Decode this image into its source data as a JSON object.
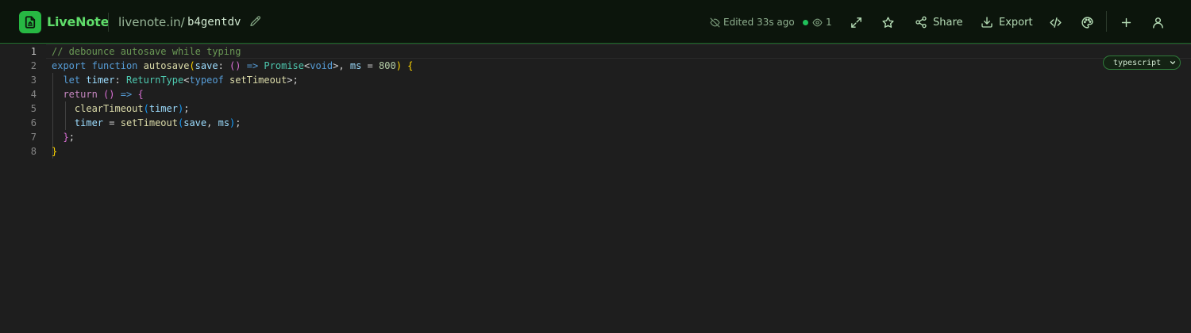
{
  "app": {
    "name": "LiveNote",
    "url_domain": "livenote.in/",
    "note_id": "b4gentdv"
  },
  "status": {
    "edited": "Edited 33s ago",
    "viewers": "1"
  },
  "toolbar": {
    "share_label": "Share",
    "export_label": "Export"
  },
  "editor": {
    "language": "typescript",
    "line_numbers": [
      "1",
      "2",
      "3",
      "4",
      "5",
      "6",
      "7",
      "8"
    ],
    "active_line": "1",
    "lines": [
      "// debounce autosave while typing",
      "export function autosave(save: () => Promise<void>, ms = 800) {",
      "  let timer: ReturnType<typeof setTimeout>;",
      "  return () => {",
      "    clearTimeout(timer);",
      "    timer = setTimeout(save, ms);",
      "  };",
      "}"
    ]
  },
  "colors": {
    "brand": "#27b843",
    "header_bg": "#0c150c",
    "editor_bg": "#1e1e1e",
    "online_dot": "#20c05a"
  },
  "icons": {
    "logo": "note-file-icon",
    "edit": "pencil-icon",
    "status": "eye-off-icon",
    "viewers": "eye-icon",
    "fullscreen": "expand-icon",
    "favorite": "star-icon",
    "share": "share-icon",
    "export": "download-icon",
    "embed": "code-icon",
    "theme": "palette-icon",
    "new": "plus-icon",
    "account": "user-icon"
  }
}
